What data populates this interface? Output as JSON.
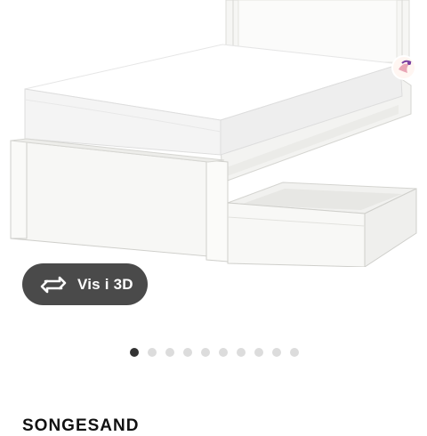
{
  "view_3d": {
    "label": "Vis i 3D",
    "icon": "rotate-3d-icon"
  },
  "carousel": {
    "total": 10,
    "active_index": 0
  },
  "product": {
    "name": "SONGESAND"
  },
  "colors": {
    "button_bg": "#4a4a4a",
    "dot_active": "#333333",
    "dot_inactive": "#dcdcdc"
  }
}
